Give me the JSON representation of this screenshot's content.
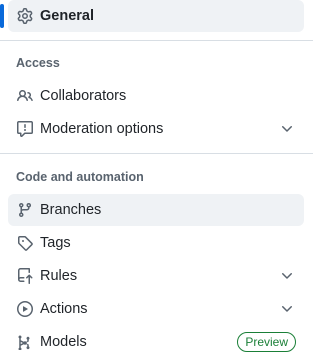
{
  "nav": {
    "general": {
      "label": "General",
      "icon": "gear-icon"
    },
    "access": {
      "title": "Access",
      "items": [
        {
          "label": "Collaborators",
          "icon": "people-icon"
        },
        {
          "label": "Moderation options",
          "icon": "report-icon"
        }
      ]
    },
    "code_automation": {
      "title": "Code and automation",
      "items": [
        {
          "label": "Branches",
          "icon": "git-branch-icon"
        },
        {
          "label": "Tags",
          "icon": "tag-icon"
        },
        {
          "label": "Rules",
          "icon": "repo-push-icon"
        },
        {
          "label": "Actions",
          "icon": "play-icon"
        },
        {
          "label": "Models",
          "icon": "ai-model-icon",
          "badge": "Preview"
        }
      ]
    }
  },
  "colors": {
    "accent": "#0969da",
    "badge": "#1a7f37",
    "text": "#1f2328",
    "muted": "#59636e"
  }
}
